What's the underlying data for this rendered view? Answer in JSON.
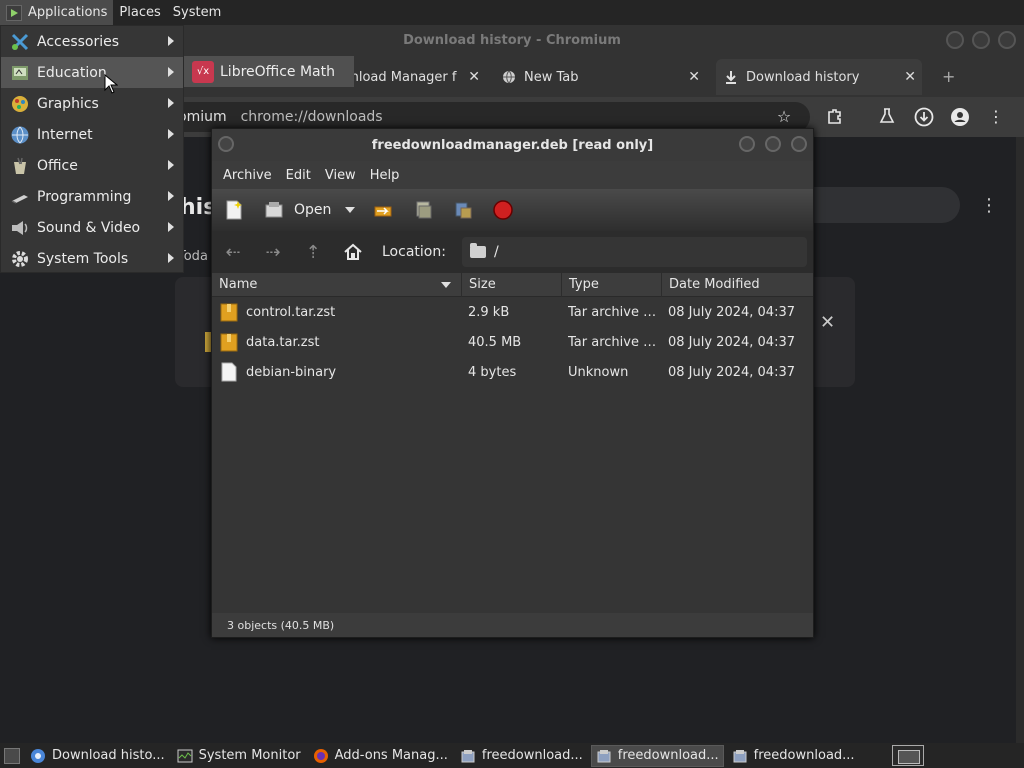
{
  "top_panel": {
    "menus": [
      "Applications",
      "Places",
      "System"
    ]
  },
  "applications_menu": {
    "items": [
      {
        "label": "Accessories",
        "icon": "accessories-icon"
      },
      {
        "label": "Education",
        "icon": "education-icon"
      },
      {
        "label": "Graphics",
        "icon": "graphics-icon"
      },
      {
        "label": "Internet",
        "icon": "internet-icon"
      },
      {
        "label": "Office",
        "icon": "office-icon"
      },
      {
        "label": "Programming",
        "icon": "programming-icon"
      },
      {
        "label": "Sound & Video",
        "icon": "sound-video-icon"
      },
      {
        "label": "System Tools",
        "icon": "system-tools-icon"
      }
    ],
    "highlighted": "Education",
    "submenu": {
      "label": "LibreOffice Math",
      "icon": "libreoffice-math-icon"
    }
  },
  "chromium": {
    "window_title": "Download history - Chromium",
    "tabs": [
      {
        "label": "wnload Manager f",
        "icon": "tab-icon"
      },
      {
        "label": "New Tab",
        "icon": "globe-icon"
      },
      {
        "label": "Download history",
        "icon": "download-icon"
      }
    ],
    "omnibox": {
      "prefix": "omium",
      "url": "chrome://downloads"
    },
    "page": {
      "heading_fragment": "his",
      "today_fragment": "Toda"
    }
  },
  "file_roller": {
    "title": "freedownloadmanager.deb [read only]",
    "menu": [
      "Archive",
      "Edit",
      "View",
      "Help"
    ],
    "toolbar": {
      "open_label": "Open"
    },
    "location": {
      "label": "Location:",
      "path": "/"
    },
    "columns": [
      "Name",
      "Size",
      "Type",
      "Date Modified"
    ],
    "files": [
      {
        "name": "control.tar.zst",
        "size": "2.9 kB",
        "type": "Tar archive (…",
        "date": "08 July 2024, 04:37",
        "icon": "archive-icon"
      },
      {
        "name": "data.tar.zst",
        "size": "40.5 MB",
        "type": "Tar archive (…",
        "date": "08 July 2024, 04:37",
        "icon": "archive-icon"
      },
      {
        "name": "debian-binary",
        "size": "4 bytes",
        "type": "Unknown",
        "date": "08 July 2024, 04:37",
        "icon": "file-icon"
      }
    ],
    "status": "3 objects (40.5 MB)"
  },
  "taskbar": {
    "tasks": [
      {
        "label": "Download histo...",
        "icon": "chromium-icon",
        "active": false
      },
      {
        "label": "System Monitor",
        "icon": "system-monitor-icon",
        "active": false
      },
      {
        "label": "Add-ons Manag...",
        "icon": "firefox-icon",
        "active": false
      },
      {
        "label": "freedownload...",
        "icon": "archive-manager-icon",
        "active": false
      },
      {
        "label": "freedownload...",
        "icon": "archive-manager-icon",
        "active": true
      },
      {
        "label": "freedownload...",
        "icon": "archive-manager-icon",
        "active": false
      }
    ]
  },
  "colors": {
    "panel": "#252525",
    "menu_bg": "#363636",
    "menu_highlight": "#555555",
    "window_bg": "#3c3c3c",
    "list_bg": "#353535",
    "record_red": "#d02020",
    "archive_yellow": "#e0a020",
    "libreoffice_math": "#c8384f"
  }
}
